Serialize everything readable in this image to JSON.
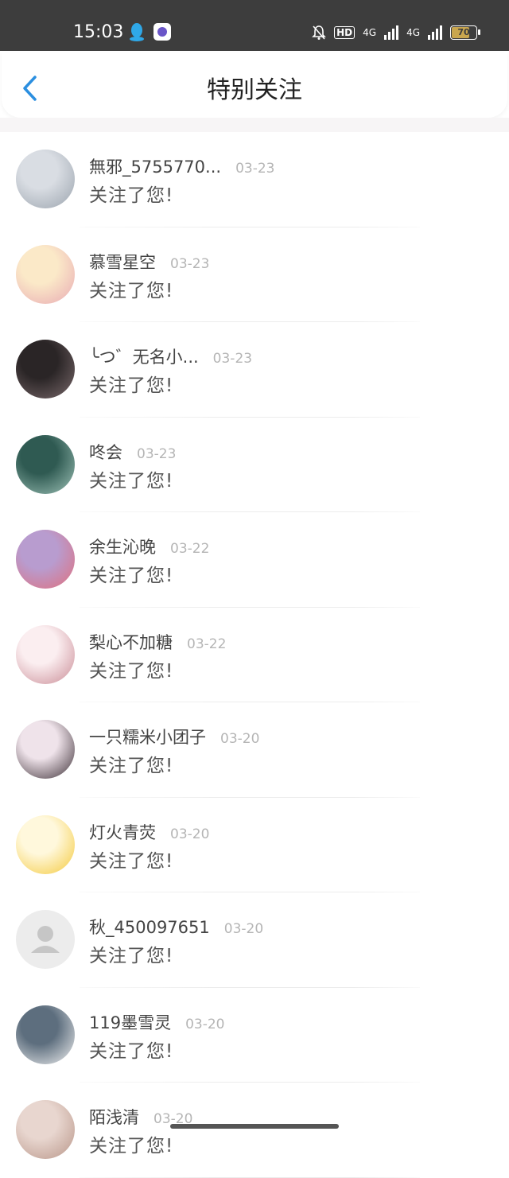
{
  "status_bar": {
    "time": "15:03",
    "hd": "HD",
    "net1": "4G",
    "net2": "4G",
    "battery": "70"
  },
  "header": {
    "title": "特别关注"
  },
  "items": [
    {
      "name": "無邪_5755770...",
      "date": "03-23",
      "message": "关注了您!",
      "avatar_colors": [
        "#d9dde3",
        "#9aa3ad"
      ]
    },
    {
      "name": "慕雪星空",
      "date": "03-23",
      "message": "关注了您!",
      "avatar_colors": [
        "#fbe9c8",
        "#e8a9b3"
      ]
    },
    {
      "name": "╰つ゛无名小...",
      "date": "03-23",
      "message": "关注了您!",
      "avatar_colors": [
        "#2a2526",
        "#7b6a6c"
      ]
    },
    {
      "name": "咚会",
      "date": "03-23",
      "message": "关注了您!",
      "avatar_colors": [
        "#2f5a52",
        "#9fc3b8"
      ]
    },
    {
      "name": "余生沁晚",
      "date": "03-22",
      "message": "关注了您!",
      "avatar_colors": [
        "#b89ccf",
        "#e06f7c"
      ]
    },
    {
      "name": "梨心不加糖",
      "date": "03-22",
      "message": "关注了您!",
      "avatar_colors": [
        "#fbeef0",
        "#c98b95"
      ]
    },
    {
      "name": "一只糯米小团子",
      "date": "03-20",
      "message": "关注了您!",
      "avatar_colors": [
        "#efe3ea",
        "#3c2f36"
      ]
    },
    {
      "name": "灯火青荧",
      "date": "03-20",
      "message": "关注了您!",
      "avatar_colors": [
        "#fff8dc",
        "#f4c93c"
      ]
    },
    {
      "name": "秋_450097651",
      "date": "03-20",
      "message": "关注了您!",
      "avatar_colors": [
        "#ececec",
        "#c6c6c6"
      ]
    },
    {
      "name": "119墨雪灵",
      "date": "03-20",
      "message": "关注了您!",
      "avatar_colors": [
        "#5d6e7e",
        "#f2f2f2"
      ]
    },
    {
      "name": "陌浅清",
      "date": "03-20",
      "message": "关注了您!",
      "avatar_colors": [
        "#e8d6cf",
        "#b89588"
      ]
    }
  ]
}
